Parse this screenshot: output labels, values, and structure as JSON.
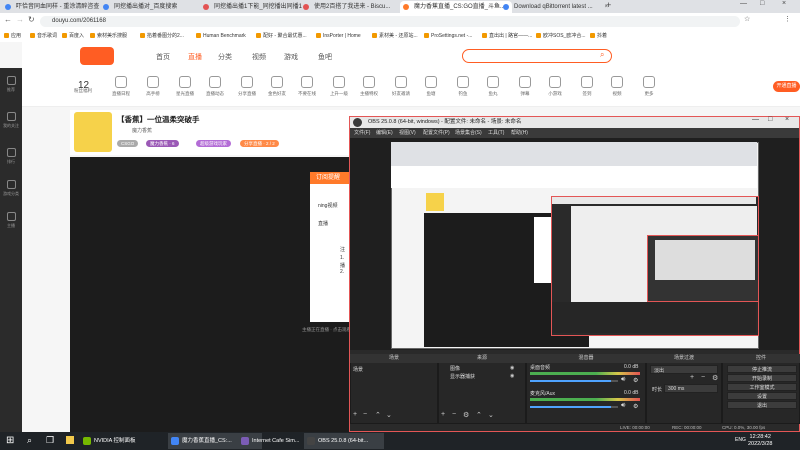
{
  "browser": {
    "tabs": [
      {
        "label": "吓恰音同血同样 - 重涂清醉咨查",
        "color": "#4285f4"
      },
      {
        "label": "同挖播出播对_百度搜索",
        "color": "#4285f4"
      },
      {
        "label": "同挖播出播1下能_同挖播出同播1",
        "color": "#e35353"
      },
      {
        "label": "使用2百搭了我进来 - Biscu...",
        "color": "#e35353"
      },
      {
        "label": "魔力香蕉直播_CS:GO直播_斗鱼...",
        "color": "#ff7a2a"
      },
      {
        "label": "Download qBittorrent latest ...",
        "color": "#4285f4"
      }
    ],
    "new_tab": "+",
    "url": "douyu.com/2061168",
    "bookmarks": [
      "应用",
      "音乐歌词",
      "百度入",
      "索材美乐搜服",
      "掐着番图分的2...",
      "Human Benchmark",
      "配好 - 聚合最优惠...",
      "InsPorter | Home",
      "素材美 - 还原站...",
      "ProSettings.net -...",
      "直出出 | 路官——...",
      "欧冲SOS_欧冲合...",
      "抖着"
    ]
  },
  "douyu": {
    "nav": [
      "首页",
      "直播",
      "分类",
      "视频",
      "游戏",
      "鱼吧"
    ],
    "level_count": "12",
    "toolbar_items": [
      "粉丝福利",
      "直播日程",
      "高手榜",
      "星光直播",
      "直播动态",
      "分享直播",
      "金色好友",
      "不要在线",
      "上升一级",
      "主播特权",
      "好友邀请",
      "鱼塘",
      "钓鱼",
      "鱼丸",
      "弹幕",
      "小游戏",
      "签到",
      "视频",
      "更多"
    ],
    "rail": [
      "推荐",
      "我的关注",
      "排行",
      "游戏分类",
      "主播"
    ],
    "cta": "开通直播",
    "stream_title": "【香蕉】一位温柔突破手",
    "streamer_name": "魔力香蕉",
    "tags": [
      "CSGO",
      "魔力香蕉 · 6",
      "超级游戏玩家",
      "分享直播 · 2 / 2"
    ],
    "dialog_title": "订阅提醒",
    "dialog_lines": [
      "ning视频",
      "直播",
      "注",
      "1.",
      "播",
      "2."
    ],
    "hint": "主播正在直播 · 点击观看更多精彩"
  },
  "obs": {
    "title": "OBS 25.0.8 (64-bit, windows) - 配置文件: 未命名 - 场景: 未命名",
    "menu": [
      "文件(F)",
      "编辑(E)",
      "视图(V)",
      "配置文件(P)",
      "场景集合(S)",
      "工具(T)",
      "帮助(H)"
    ],
    "docks": {
      "scenes": {
        "title": "场景",
        "items": [
          "场景"
        ]
      },
      "sources": {
        "title": "来源",
        "items": [
          "图像",
          "显示器捕获"
        ]
      },
      "mixer": {
        "title": "混音器",
        "channels": [
          {
            "name": "桌面音频",
            "db": "0.0 dB",
            "level": 0.92
          },
          {
            "name": "麦克风/Aux",
            "db": "0.0 dB",
            "level": 0.92
          }
        ]
      },
      "transitions": {
        "title": "场景过渡",
        "type": "淡出",
        "duration_label": "时长",
        "duration": "300 ms"
      },
      "controls": {
        "title": "控件",
        "buttons": [
          "停止推流",
          "开始录制",
          "工作室模式",
          "设置",
          "退出"
        ]
      }
    },
    "status": {
      "live": "LIVE: 00:00:00",
      "rec": "REC: 00:00:00",
      "cpu": "CPU: 0.0%, 30.00 fps"
    }
  },
  "taskbar": {
    "apps": [
      {
        "label": "NVIDIA 控制面板",
        "color": "#76b900"
      },
      {
        "label": "魔力香蕉直播_CS:...",
        "color": "#4285f4"
      },
      {
        "label": "Internet Cafe Sim...",
        "color": "#7b5cb5"
      },
      {
        "label": "OBS 25.0.8 (64-bit...",
        "color": "#444"
      }
    ],
    "lang": "ENG",
    "time": "12:28:42",
    "date": "2022/3/28"
  }
}
